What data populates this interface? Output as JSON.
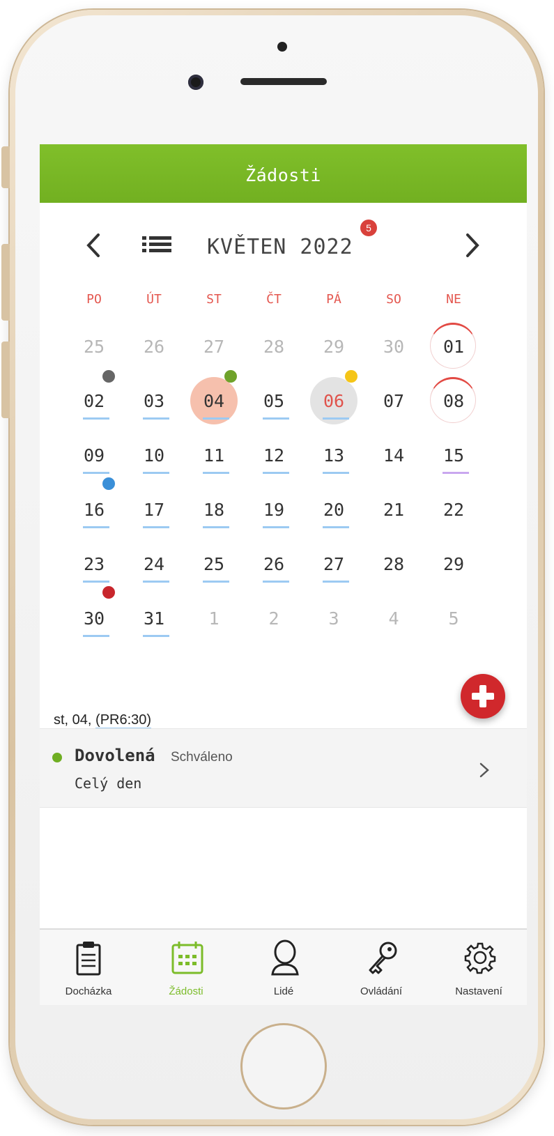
{
  "header": {
    "title": "Žádosti"
  },
  "calendar": {
    "month_title": "KVĚTEN 2022",
    "badge_count": "5",
    "day_names": [
      "PO",
      "ÚT",
      "ST",
      "ČT",
      "PÁ",
      "SO",
      "NE"
    ],
    "weeks": [
      [
        "25",
        "26",
        "27",
        "28",
        "29",
        "30",
        "01"
      ],
      [
        "02",
        "03",
        "04",
        "05",
        "06",
        "07",
        "08"
      ],
      [
        "09",
        "10",
        "11",
        "12",
        "13",
        "14",
        "15"
      ],
      [
        "16",
        "17",
        "18",
        "19",
        "20",
        "21",
        "22"
      ],
      [
        "23",
        "24",
        "25",
        "26",
        "27",
        "28",
        "29"
      ],
      [
        "30",
        "31",
        "1",
        "2",
        "3",
        "4",
        "5"
      ]
    ],
    "selected_day": "04",
    "today": "06"
  },
  "selected_date": {
    "day_label": "st, 04, ",
    "period": "(PR6:30)"
  },
  "request": {
    "type": "Dovolená",
    "status": "Schváleno",
    "duration": "Celý den",
    "status_color": "#6fae22"
  },
  "tabs": [
    {
      "label": "Docházka",
      "icon": "clipboard-icon"
    },
    {
      "label": "Žádosti",
      "icon": "calendar-icon",
      "active": true
    },
    {
      "label": "Lidé",
      "icon": "person-icon"
    },
    {
      "label": "Ovládání",
      "icon": "key-icon"
    },
    {
      "label": "Nastavení",
      "icon": "gear-icon"
    }
  ],
  "colors": {
    "brand_green": "#78b825",
    "accent_red": "#d0282c",
    "weekday_red": "#e4574f",
    "marker_gray": "#666666",
    "marker_green": "#6fa22a",
    "marker_yellow": "#f5c518",
    "marker_blue": "#3a8fd8",
    "marker_red": "#c8262c"
  }
}
